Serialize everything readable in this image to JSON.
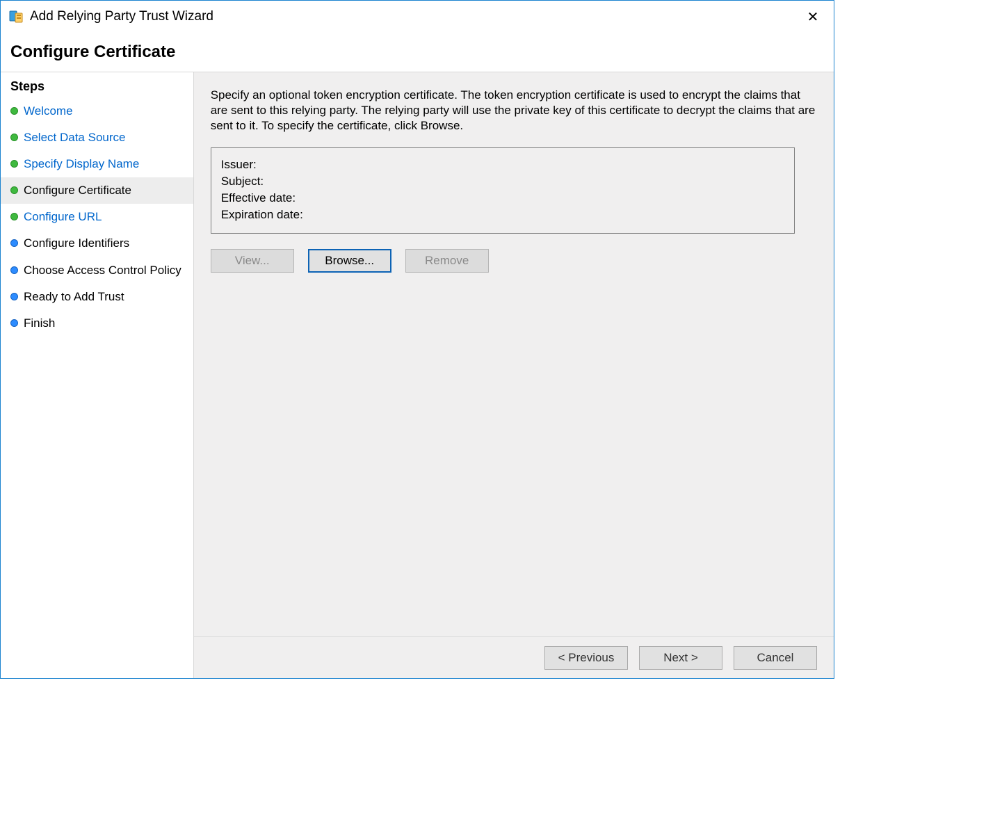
{
  "titlebar": {
    "title": "Add Relying Party Trust Wizard",
    "close_glyph": "✕"
  },
  "heading": "Configure Certificate",
  "sidebar": {
    "title": "Steps",
    "steps": [
      {
        "label": "Welcome",
        "state": "done"
      },
      {
        "label": "Select Data Source",
        "state": "done"
      },
      {
        "label": "Specify Display Name",
        "state": "done"
      },
      {
        "label": "Configure Certificate",
        "state": "current"
      },
      {
        "label": "Configure URL",
        "state": "done"
      },
      {
        "label": "Configure Identifiers",
        "state": "future"
      },
      {
        "label": "Choose Access Control Policy",
        "state": "future"
      },
      {
        "label": "Ready to Add Trust",
        "state": "future"
      },
      {
        "label": "Finish",
        "state": "future"
      }
    ]
  },
  "main": {
    "description": "Specify an optional token encryption certificate.  The token encryption certificate is used to encrypt the claims that are sent to this relying party.  The relying party will use the private key of this certificate to decrypt the claims that are sent to it.  To specify the certificate, click Browse.",
    "cert": {
      "issuer_label": "Issuer:",
      "issuer_value": "",
      "subject_label": "Subject:",
      "subject_value": "",
      "effective_label": "Effective date:",
      "effective_value": "",
      "expiration_label": "Expiration date:",
      "expiration_value": ""
    },
    "buttons": {
      "view": "View...",
      "browse": "Browse...",
      "remove": "Remove"
    }
  },
  "footer": {
    "previous": "< Previous",
    "next": "Next >",
    "cancel": "Cancel"
  }
}
